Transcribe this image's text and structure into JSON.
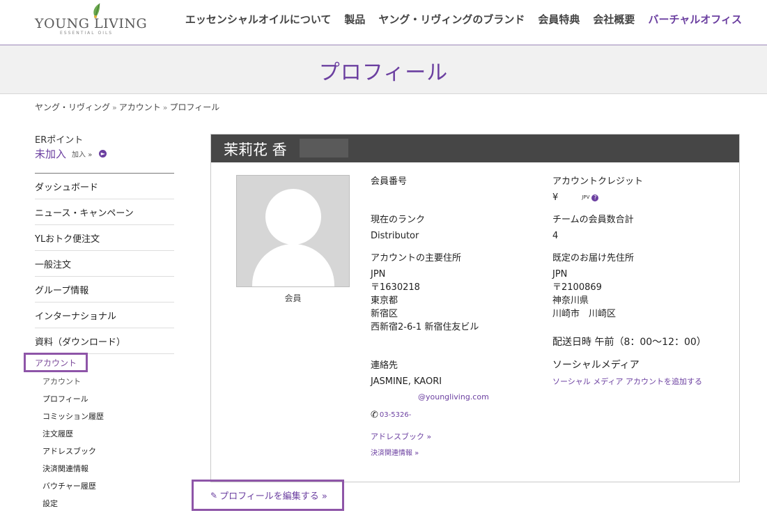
{
  "logo": {
    "text": "YOUNG LIVING",
    "sub": "ESSENTIAL OILS"
  },
  "nav": [
    {
      "label": "エッセンシャルオイルについて",
      "active": false
    },
    {
      "label": "製品",
      "active": false
    },
    {
      "label": "ヤング・リヴィングのブランド",
      "active": false
    },
    {
      "label": "会員特典",
      "active": false
    },
    {
      "label": "会社概要",
      "active": false
    },
    {
      "label": "バーチャルオフィス",
      "active": true
    }
  ],
  "page_title": "プロフィール",
  "breadcrumb": {
    "items": [
      "ヤング・リヴィング",
      "アカウント",
      "プロフィール"
    ],
    "separator": "»"
  },
  "sidebar": {
    "er_label": "ERポイント",
    "er_status": "未加入",
    "er_join": "加入 »",
    "items": [
      "ダッシュボード",
      "ニュース・キャンペーン",
      "YLおトク便注文",
      "一般注文",
      "グループ情報",
      "インターナショナル",
      "資料（ダウンロード）"
    ],
    "account_label": "アカウント",
    "sub_items": [
      "アカウント",
      "プロフィール",
      "コミッション履歴",
      "注文履歴",
      "アドレスブック",
      "決済関連情報",
      "バウチャー履歴",
      "設定"
    ]
  },
  "profile": {
    "name": "茉莉花 香",
    "avatar_caption": "会員",
    "member_number_label": "会員番号",
    "account_credit_label": "アカウントクレジット",
    "account_credit_currency": "¥",
    "account_credit_unit": "JPV",
    "rank_label": "現在のランク",
    "rank_value": "Distributor",
    "team_total_label": "チームの会員数合計",
    "team_total_value": "4",
    "primary_address_label": "アカウントの主要住所",
    "primary_address": [
      "JPN",
      "〒1630218",
      "東京都",
      "新宿区",
      "西新宿2-6-1 新宿住友ビル"
    ],
    "shipping_address_label": "既定のお届け先住所",
    "shipping_address": [
      "JPN",
      "〒2100869",
      "神奈川県",
      "川崎市　川崎区"
    ],
    "delivery_time": "配送日時 午前（8：00～12：00）",
    "contact_label": "連絡先",
    "contact_name": "JASMINE, KAORI",
    "contact_email": "@youngliving.com",
    "contact_phone": "03-5326-",
    "social_label": "ソーシャルメディア",
    "social_link": "ソーシャル メディア アカウントを追加する",
    "address_book_link": "アドレスブック »",
    "payment_link": "決済関連情報 »"
  },
  "edit_profile": "プロフィールを編集する »",
  "colors": {
    "brand": "#6b3fa0",
    "panel_header": "#464646",
    "highlight_border": "#8e55a8"
  }
}
